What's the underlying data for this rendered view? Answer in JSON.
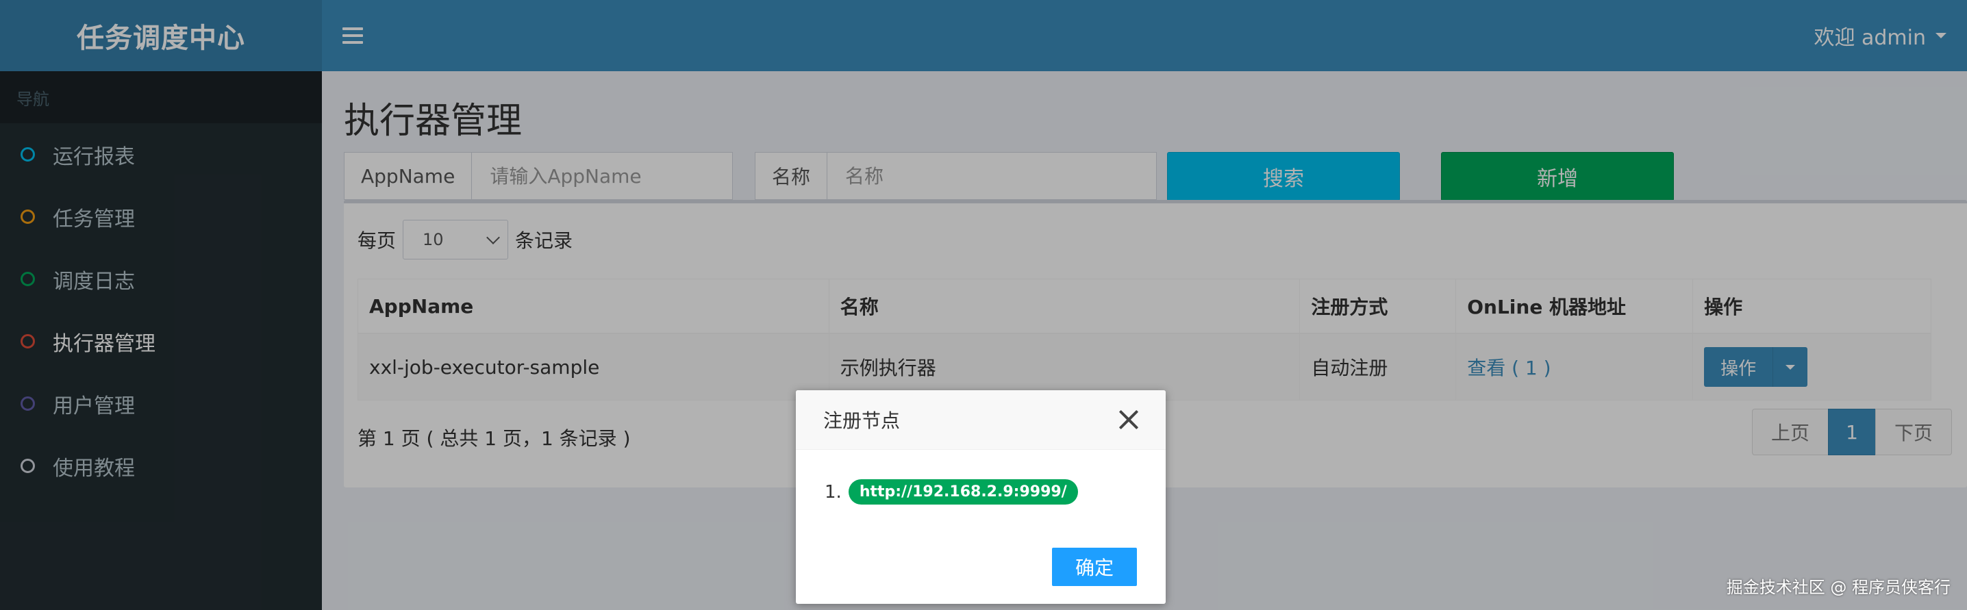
{
  "header": {
    "logo_text": "任务调度中心",
    "user_greeting": "欢迎 admin"
  },
  "sidebar": {
    "nav_header": "导航",
    "items": [
      {
        "label": "运行报表",
        "icon_color": "#00c0ef"
      },
      {
        "label": "任务管理",
        "icon_color": "#f39c12"
      },
      {
        "label": "调度日志",
        "icon_color": "#00a65a"
      },
      {
        "label": "执行器管理",
        "icon_color": "#dd4b39"
      },
      {
        "label": "用户管理",
        "icon_color": "#605ca8"
      },
      {
        "label": "使用教程",
        "icon_color": "#d2d6de"
      }
    ]
  },
  "main": {
    "title": "执行器管理",
    "filters": {
      "appname_label": "AppName",
      "appname_placeholder": "请输入AppName",
      "name_label": "名称",
      "name_placeholder": "名称"
    },
    "buttons": {
      "search": "搜索",
      "add": "新增"
    },
    "length": {
      "prefix": "每页",
      "value": "10",
      "suffix": "条记录"
    },
    "table": {
      "columns": [
        "AppName",
        "名称",
        "注册方式",
        "OnLine 机器地址",
        "操作"
      ],
      "rows": [
        {
          "appname": "xxl-job-executor-sample",
          "name": "示例执行器",
          "register_type": "自动注册",
          "online": "查看 ( 1 )",
          "action": "操作"
        }
      ]
    },
    "info": "第 1 页 ( 总共 1 页，1 条记录 )",
    "pagination": {
      "prev": "上页",
      "current": "1",
      "next": "下页"
    }
  },
  "modal": {
    "title": "注册节点",
    "list_index": "1.",
    "address": "http://192.168.2.9:9999/",
    "ok": "确定"
  },
  "watermark": "掘金技术社区 @ 程序员侠客行",
  "colors": {
    "header": "#3c8dbc",
    "logo": "#367fa9",
    "sidebar": "#222d32",
    "search_button": "#00c0ef",
    "add_button": "#00a65a",
    "ok_button": "#1e9fff"
  }
}
